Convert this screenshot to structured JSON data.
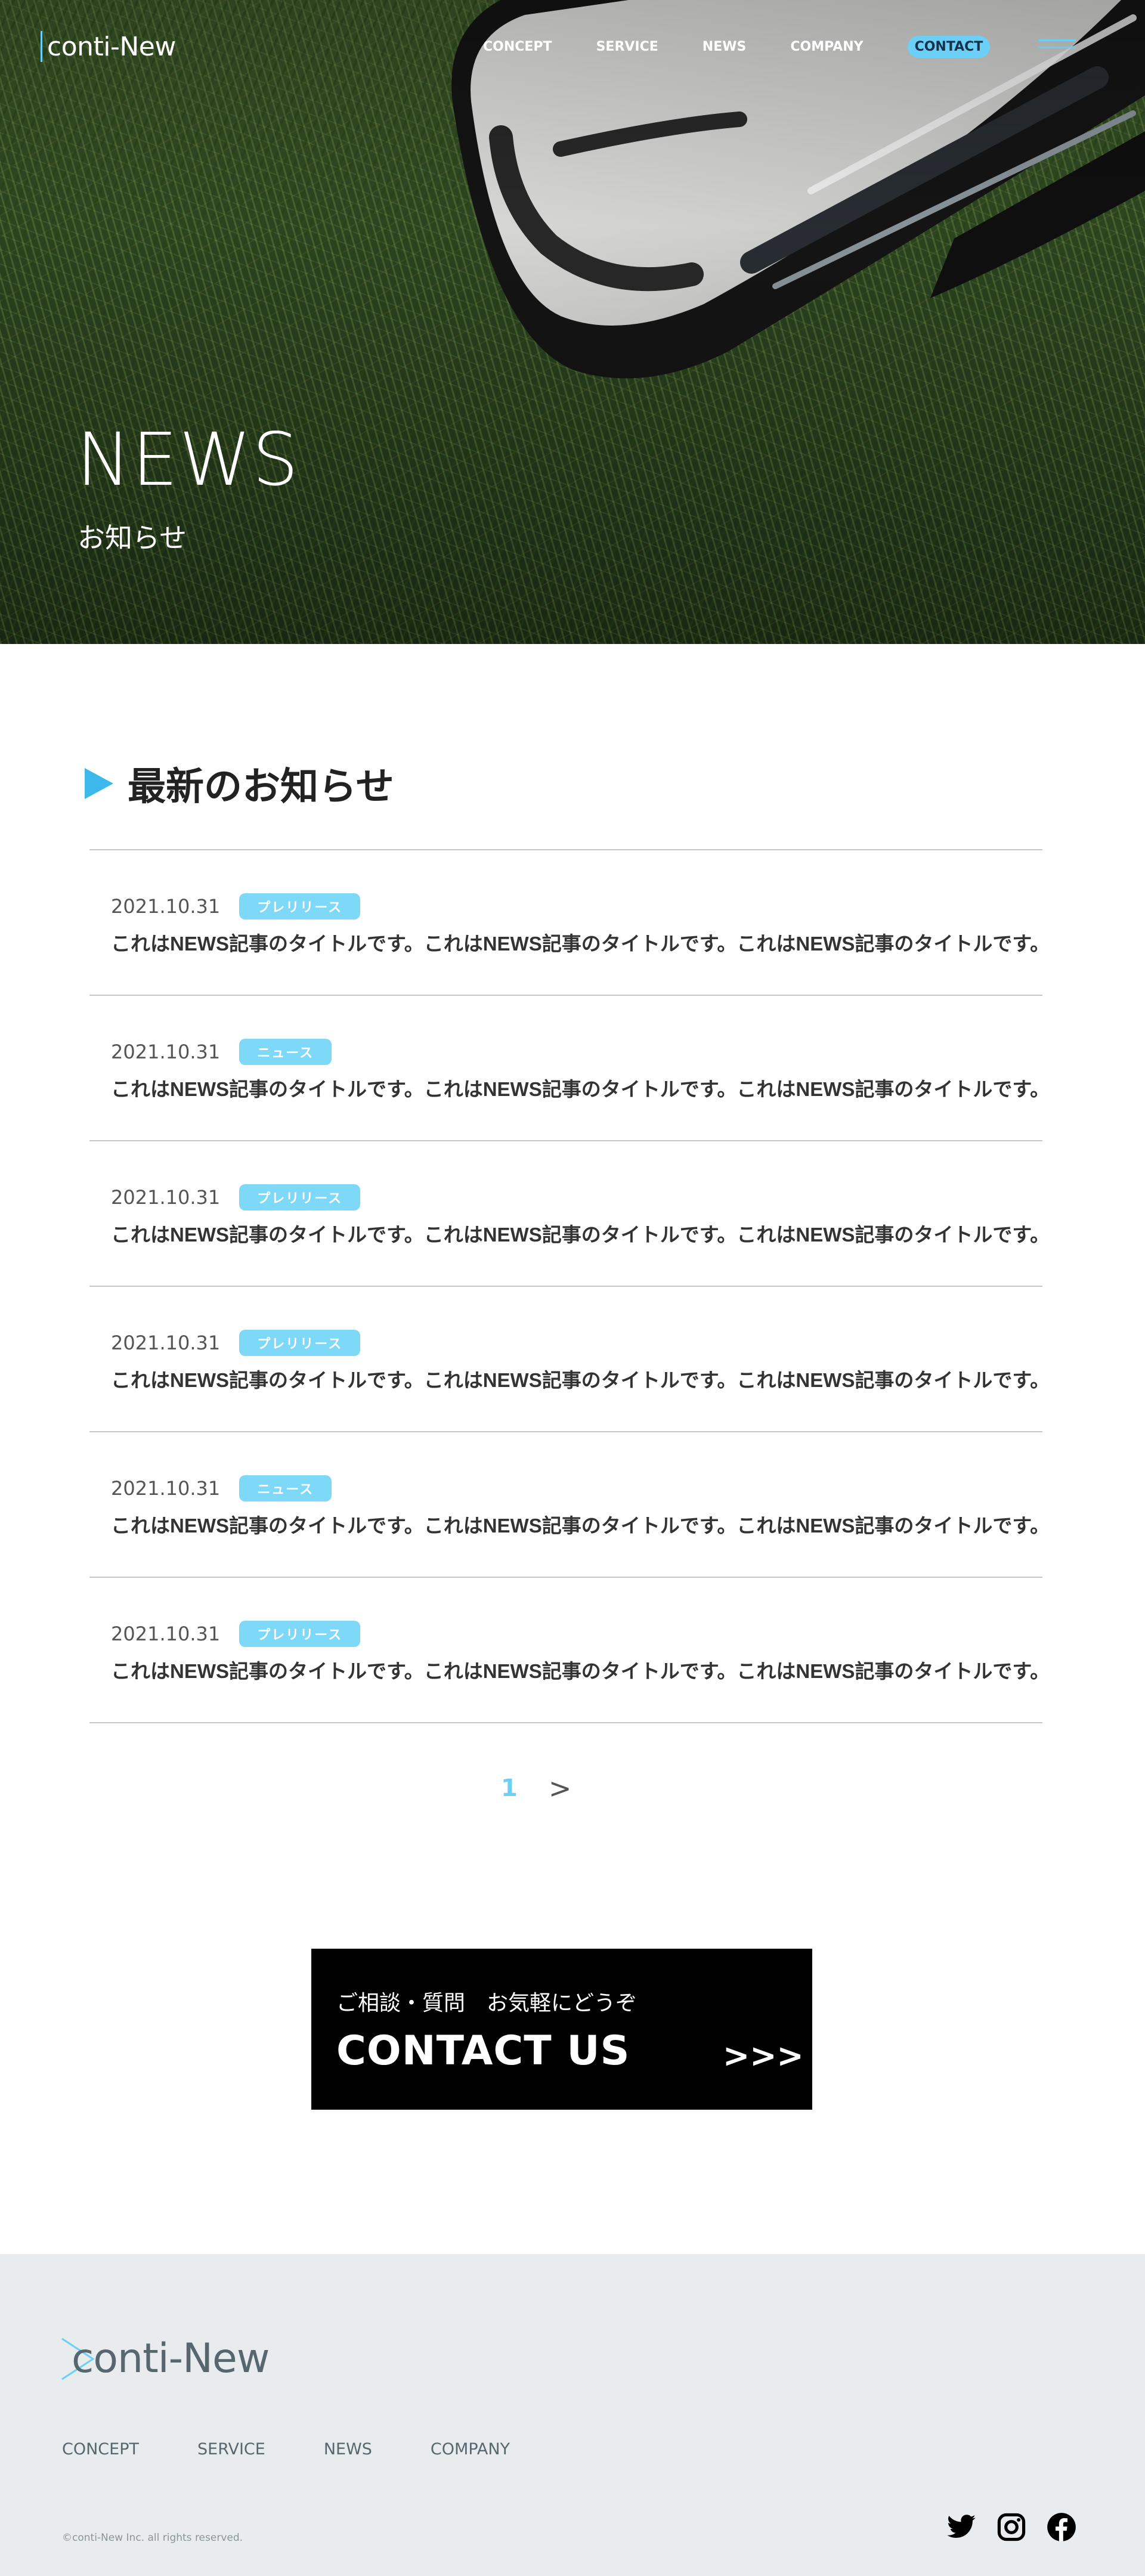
{
  "header": {
    "logo": "conti-New",
    "nav": [
      {
        "label": "CONCEPT"
      },
      {
        "label": "SERVICE"
      },
      {
        "label": "NEWS"
      },
      {
        "label": "COMPANY"
      }
    ],
    "contact_label": "CONTACT",
    "menu_icon": "hamburger-icon"
  },
  "hero": {
    "title": "NEWS",
    "subtitle": "お知らせ"
  },
  "news": {
    "heading": "最新のお知らせ",
    "items": [
      {
        "date": "2021.10.31",
        "category": "プレリリース",
        "title": "これはNEWS記事のタイトルです。これはNEWS記事のタイトルです。これはNEWS記事のタイトルです。"
      },
      {
        "date": "2021.10.31",
        "category": "ニュース",
        "title": "これはNEWS記事のタイトルです。これはNEWS記事のタイトルです。これはNEWS記事のタイトルです。"
      },
      {
        "date": "2021.10.31",
        "category": "プレリリース",
        "title": "これはNEWS記事のタイトルです。これはNEWS記事のタイトルです。これはNEWS記事のタイトルです。"
      },
      {
        "date": "2021.10.31",
        "category": "プレリリース",
        "title": "これはNEWS記事のタイトルです。これはNEWS記事のタイトルです。これはNEWS記事のタイトルです。"
      },
      {
        "date": "2021.10.31",
        "category": "ニュース",
        "title": "これはNEWS記事のタイトルです。これはNEWS記事のタイトルです。これはNEWS記事のタイトルです。"
      },
      {
        "date": "2021.10.31",
        "category": "プレリリース",
        "title": "これはNEWS記事のタイトルです。これはNEWS記事のタイトルです。これはNEWS記事のタイトルです。"
      }
    ]
  },
  "pagination": {
    "current": "1",
    "next": ">"
  },
  "contact": {
    "lead": "ご相談・質問　お気軽にどうぞ",
    "title": "CONTACT US",
    "arrows": ">>>"
  },
  "footer": {
    "logo": "conti-New",
    "nav": [
      {
        "label": "CONCEPT"
      },
      {
        "label": "SERVICE"
      },
      {
        "label": "NEWS"
      },
      {
        "label": "COMPANY"
      }
    ],
    "copyright": "©conti-New Inc. all rights reserved.",
    "social": [
      "twitter-icon",
      "instagram-icon",
      "facebook-icon"
    ]
  },
  "colors": {
    "accent": "#6ccff5",
    "accent_dark": "#3cb8ea",
    "footer_bg": "#e8ecee",
    "contact_bg": "#000000"
  }
}
